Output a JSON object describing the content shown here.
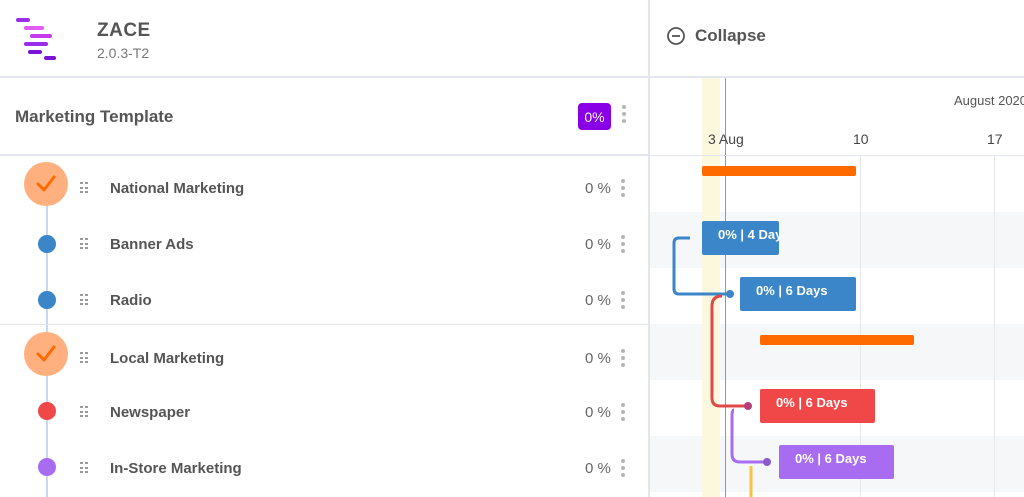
{
  "app": {
    "name": "ZACE",
    "version": "2.0.3-T2"
  },
  "project": {
    "title": "Marketing Template",
    "progress_badge": "0%"
  },
  "tasks": [
    {
      "name": "National Marketing",
      "pct": "0 %",
      "kind": "summary",
      "color": "#ff6a00"
    },
    {
      "name": "Banner Ads",
      "pct": "0 %",
      "kind": "task",
      "color": "#3a86c8"
    },
    {
      "name": "Radio",
      "pct": "0 %",
      "kind": "task",
      "color": "#3a86c8"
    },
    {
      "name": "Local Marketing",
      "pct": "0 %",
      "kind": "summary",
      "color": "#ff6a00"
    },
    {
      "name": "Newspaper",
      "pct": "0 %",
      "kind": "task",
      "color": "#f04848"
    },
    {
      "name": "In-Store Marketing",
      "pct": "0 %",
      "kind": "task",
      "color": "#a86cf0"
    }
  ],
  "gantt": {
    "collapse_label": "Collapse",
    "month_label": "August 2020",
    "ticks": [
      "3 Aug",
      "10",
      "17"
    ],
    "bars": [
      {
        "task": "National Marketing",
        "label": "",
        "color": "#ff6a00"
      },
      {
        "task": "Banner Ads",
        "label": "0% | 4 Days",
        "color": "#3a86c8"
      },
      {
        "task": "Radio",
        "label": "0% | 6 Days",
        "color": "#3a86c8"
      },
      {
        "task": "Local Marketing",
        "label": "",
        "color": "#ff6a00"
      },
      {
        "task": "Newspaper",
        "label": "0% | 6 Days",
        "color": "#f04848"
      },
      {
        "task": "In-Store Marketing",
        "label": "0% | 6 Days",
        "color": "#a86cf0"
      }
    ],
    "dependencies": [
      {
        "from": "Banner Ads",
        "to": "Radio",
        "color": "#3a86c8"
      },
      {
        "from": "Radio",
        "to": "Newspaper",
        "color": "#e04848"
      },
      {
        "from": "Newspaper",
        "to": "In-Store Marketing",
        "color": "#a86cf0"
      },
      {
        "from": "In-Store Marketing",
        "to": "",
        "color": "#f5c542"
      }
    ]
  },
  "colors": {
    "accent": "#8a00e6",
    "summary": "#ff6a00",
    "check_bg": "#ffb07e"
  }
}
